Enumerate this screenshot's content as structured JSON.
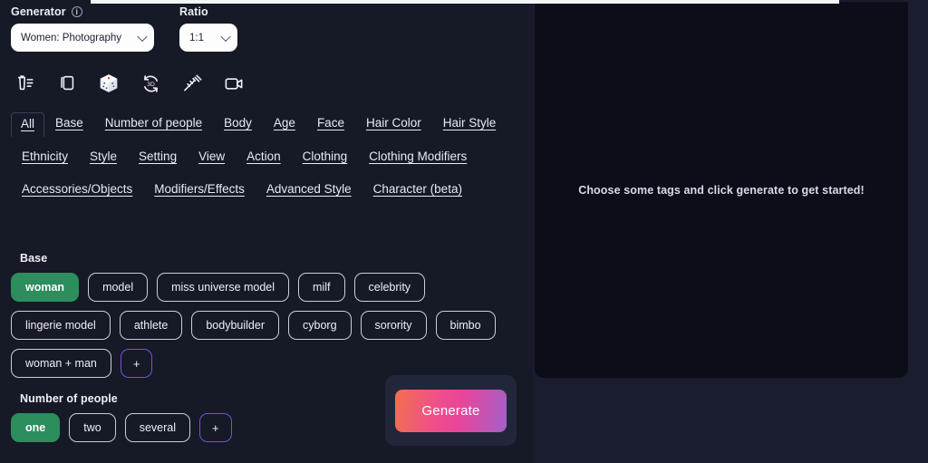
{
  "controls": {
    "generator": {
      "label": "Generator",
      "info_icon": "info-circle-icon",
      "value": "Women: Photography"
    },
    "ratio": {
      "label": "Ratio",
      "value": "1:1"
    }
  },
  "toolbar": [
    {
      "name": "clear-list-icon",
      "title": "Clear"
    },
    {
      "name": "duplicate-icon",
      "title": "Duplicate"
    },
    {
      "name": "dice-icon",
      "title": "Randomize"
    },
    {
      "name": "rotate-3d-icon",
      "title": "3D Rotate"
    },
    {
      "name": "magic-wand-icon",
      "title": "Enhance"
    },
    {
      "name": "video-camera-icon",
      "title": "Video"
    }
  ],
  "tabs": [
    {
      "label": "All",
      "active": true
    },
    {
      "label": "Base",
      "active": false
    },
    {
      "label": "Number of people",
      "active": false
    },
    {
      "label": "Body",
      "active": false
    },
    {
      "label": "Age",
      "active": false
    },
    {
      "label": "Face",
      "active": false
    },
    {
      "label": "Hair Color",
      "active": false
    },
    {
      "label": "Hair Style",
      "active": false
    },
    {
      "label": "Ethnicity",
      "active": false
    },
    {
      "label": "Style",
      "active": false
    },
    {
      "label": "Setting",
      "active": false
    },
    {
      "label": "View",
      "active": false
    },
    {
      "label": "Action",
      "active": false
    },
    {
      "label": "Clothing",
      "active": false
    },
    {
      "label": "Clothing Modifiers",
      "active": false
    },
    {
      "label": "Accessories/Objects",
      "active": false
    },
    {
      "label": "Modifiers/Effects",
      "active": false
    },
    {
      "label": "Advanced Style",
      "active": false
    },
    {
      "label": "Character (beta)",
      "active": false
    }
  ],
  "groups": [
    {
      "title": "Base",
      "chips": [
        {
          "label": "woman",
          "selected": true
        },
        {
          "label": "model",
          "selected": false
        },
        {
          "label": "miss universe model",
          "selected": false
        },
        {
          "label": "milf",
          "selected": false
        },
        {
          "label": "celebrity",
          "selected": false
        },
        {
          "label": "lingerie model",
          "selected": false
        },
        {
          "label": "athlete",
          "selected": false
        },
        {
          "label": "bodybuilder",
          "selected": false
        },
        {
          "label": "cyborg",
          "selected": false
        },
        {
          "label": "sorority",
          "selected": false
        },
        {
          "label": "bimbo",
          "selected": false
        },
        {
          "label": "woman + man",
          "selected": false
        },
        {
          "label": "+",
          "selected": false,
          "add": true
        }
      ]
    },
    {
      "title": "Number of people",
      "chips": [
        {
          "label": "one",
          "selected": true
        },
        {
          "label": "two",
          "selected": false
        },
        {
          "label": "several",
          "selected": false
        },
        {
          "label": "+",
          "selected": false,
          "add": true
        }
      ]
    }
  ],
  "generate": {
    "label": "Generate"
  },
  "preview": {
    "empty_message": "Choose some tags and click generate to get started!"
  },
  "colors": {
    "accent_green": "#2c8d5d",
    "accent_purple": "#7b4fd8",
    "panel_bg": "#161926",
    "preview_bg": "#0b0d18",
    "generate_gradient_start": "#f2704e",
    "generate_gradient_mid": "#ef4d8e",
    "generate_gradient_end": "#a361c9"
  }
}
